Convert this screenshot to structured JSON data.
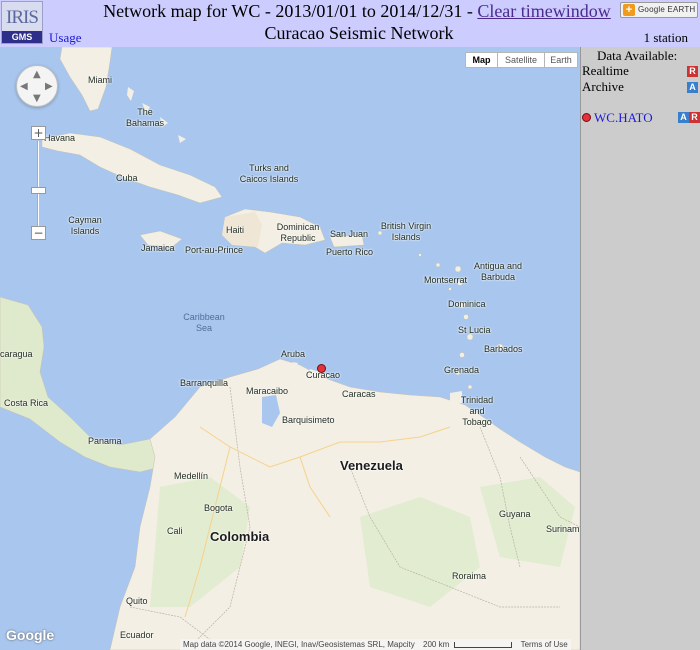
{
  "header": {
    "logo_text": "IRIS",
    "logo_sub": "GMS",
    "title": "Network map for WC - 2013/01/01 to 2014/12/31 -",
    "clear_link": "Clear timewindow",
    "subtitle": "Curacao Seismic Network",
    "usage_link": "Usage",
    "google_earth_label": "Google EARTH",
    "station_count": "1 station"
  },
  "map": {
    "type_buttons": [
      "Map",
      "Satellite",
      "Earth"
    ],
    "active_type": "Map",
    "zoom_in": "+",
    "zoom_out": "−",
    "google_logo": "Google",
    "attribution": "Map data ©2014 Google, INEGI, Inav/Geosistemas SRL, Mapcity",
    "scale_label": "200 km",
    "terms": "Terms of Use",
    "places": {
      "miami": "Miami",
      "bahamas": "The\nBahamas",
      "havana": "Havana",
      "cuba": "Cuba",
      "cayman": "Cayman\nIslands",
      "turks": "Turks and\nCaicos Islands",
      "haiti": "Haiti",
      "dominican": "Dominican\nRepublic",
      "san_juan": "San Juan",
      "bvi": "British Virgin\nIslands",
      "jamaica": "Jamaica",
      "port_au_prince": "Port-au-Prince",
      "puerto_rico": "Puerto Rico",
      "antigua": "Antigua and\nBarbuda",
      "montserrat": "Montserrat",
      "dominica": "Dominica",
      "caribbean": "Caribbean\nSea",
      "st_lucia": "St Lucia",
      "barbados": "Barbados",
      "nicaragua": "caragua",
      "aruba": "Aruba",
      "curacao": "Curacao",
      "grenada": "Grenada",
      "barranquilla": "Barranquilla",
      "maracaibo": "Maracaibo",
      "caracas": "Caracas",
      "costa_rica": "Costa Rica",
      "trinidad": "Trinidad\nand Tobago",
      "panama": "Panama",
      "barquisimeto": "Barquisimeto",
      "venezuela": "Venezuela",
      "medellin": "Medellín",
      "guyana": "Guyana",
      "bogota": "Bogota",
      "surinam": "Surinam",
      "cali": "Cali",
      "colombia": "Colombia",
      "roraima": "Roraima",
      "quito": "Quito",
      "ecuador": "Ecuador"
    }
  },
  "sidebar": {
    "data_available": "Data Available:",
    "realtime": "Realtime",
    "archive": "Archive",
    "badge_r": "R",
    "badge_a": "A",
    "station": "WC.HATO"
  },
  "colors": {
    "header_bg": "#ccccff",
    "sidebar_bg": "#cccccc",
    "water": "#a8c6ee",
    "land": "#f3efe4",
    "station": "#e3323b",
    "link": "#1a1ad6"
  }
}
